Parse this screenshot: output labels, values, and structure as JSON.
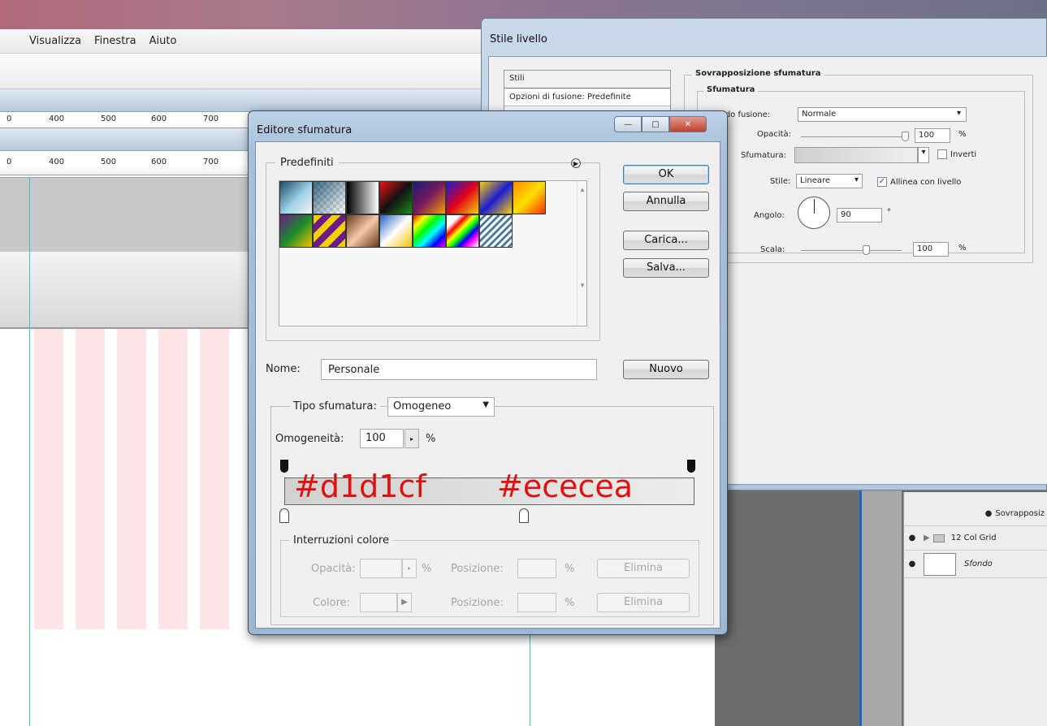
{
  "menu": {
    "visualizza": "Visualizza",
    "finestra": "Finestra",
    "aiuto": "Aiuto"
  },
  "ruler": {
    "t400": "400",
    "t500": "500",
    "t600": "600",
    "t700": "700",
    "t0": "0"
  },
  "layers": {
    "row1": "Sovrapposiz",
    "row2": "12 Col Grid",
    "row3": "Sfondo"
  },
  "stile": {
    "title": "Stile livello",
    "stili": "Stili",
    "opzioni": "Opzioni di fusione: Predefinite",
    "section": "Sovrapposizione sfumatura",
    "subsection": "Sfumatura",
    "metodo_lbl": "Metodo fusione:",
    "metodo_val": "Normale",
    "opacita_lbl": "Opacità:",
    "opacita_val": "100",
    "pct": "%",
    "sfumatura_lbl": "Sfumatura:",
    "inverti": "Inverti",
    "stile_lbl": "Stile:",
    "stile_val": "Lineare",
    "allinea": "Allinea con livello",
    "angolo_lbl": "Angolo:",
    "angolo_val": "90",
    "deg": "°",
    "scala_lbl": "Scala:",
    "scala_val": "100"
  },
  "editor": {
    "title": "Editore sfumatura",
    "predefiniti": "Predefiniti",
    "ok": "OK",
    "annulla": "Annulla",
    "carica": "Carica...",
    "salva": "Salva...",
    "nome_lbl": "Nome:",
    "nome_val": "Personale",
    "nuovo": "Nuovo",
    "tipo_lbl": "Tipo sfumatura:",
    "tipo_val": "Omogeneo",
    "omo_lbl": "Omogeneità:",
    "omo_val": "100",
    "pct": "%",
    "hex_left": "#d1d1cf",
    "hex_right": "#ececea",
    "interruzioni": "Interruzioni colore",
    "opacita_lbl": "Opacità:",
    "posizione_lbl": "Posizione:",
    "colore_lbl": "Colore:",
    "elimina": "Elimina",
    "colors": {
      "stop_left": "#d1d1cf",
      "stop_right": "#ececea",
      "annotation": "#dd1111"
    }
  }
}
